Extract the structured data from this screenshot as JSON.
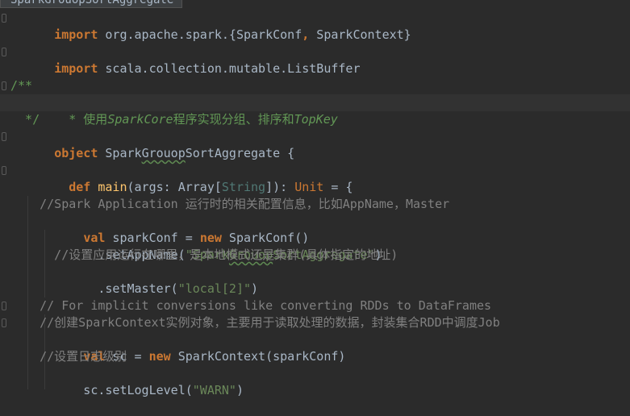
{
  "tab": {
    "filename": "SparkGrouopSortAggregate"
  },
  "lines": {
    "l0": {
      "kw": "import",
      "rest_a": " org.apache.spark.{SparkConf",
      "comma": ",",
      "rest_b": " SparkContext}"
    },
    "l2": {
      "kw": "import",
      "rest": " scala.collection.mutable.ListBuffer"
    },
    "l4": {
      "open": "/**"
    },
    "l5": {
      "star": "  * 使用",
      "tag1": "SparkCore",
      "mid": "程序实现分组、排序和",
      "tag2": "TopKey"
    },
    "l6": {
      "close": "  */"
    },
    "l7": {
      "kw": "object",
      "name_a": " Spark",
      "name_typo": "Grouop",
      "name_b": "SortAggregate {"
    },
    "l9": {
      "indent": "  ",
      "kw": "def",
      "sp": " ",
      "fn": "main",
      "p1": "(args: Array[",
      "tstr": "String",
      "p2": "]): ",
      "tunit": "Unit",
      "p3": " = {"
    },
    "l11": {
      "comment": "    //Spark Application 运行时的相关配置信息，比如AppName，Master"
    },
    "l12": {
      "indent": "    ",
      "kw_val": "val",
      "mid": " sparkConf = ",
      "kw_new": "new",
      "rest": " SparkConf()"
    },
    "l13": {
      "pre": "      .setAppName(",
      "str_a": "\"Spark",
      "str_typo": "Grouop",
      "str_b": "SortAggregate\"",
      "post": ")"
    },
    "l14": {
      "comment": "      //设置应用运行在哪里，是本地模式还是集群(具体指定的地址)"
    },
    "l15": {
      "pre": "      .setMaster(",
      "str": "\"local[2]\"",
      "post": ")"
    },
    "l17": {
      "comment": "    // For implicit conversions like converting RDDs to DataFrames"
    },
    "l18": {
      "comment": "    //创建SparkContext实例对象，主要用于读取处理的数据，封装集合RDD中调度Job"
    },
    "l19": {
      "indent": "    ",
      "kw_val": "val",
      "mid": " sc = ",
      "kw_new": "new",
      "rest": " SparkContext(sparkConf)"
    },
    "l20": {
      "comment": "    //设置日志级别"
    },
    "l21": {
      "pre": "    sc.setLogLevel(",
      "str": "\"WARN\"",
      "post": ")"
    }
  }
}
